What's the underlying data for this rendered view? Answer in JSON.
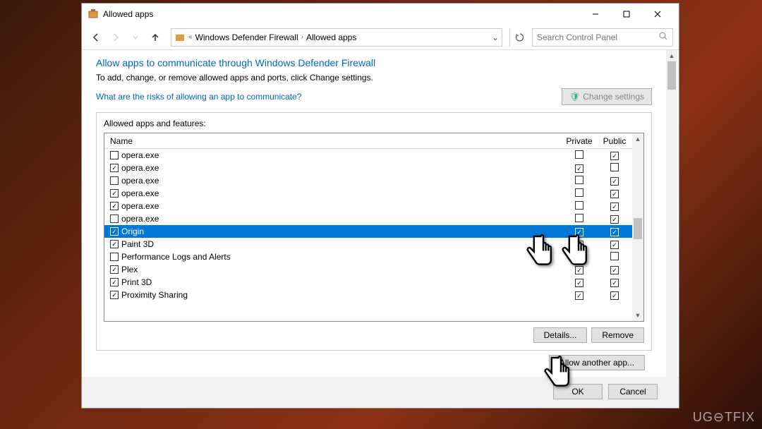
{
  "window": {
    "title": "Allowed apps"
  },
  "toolbar": {
    "breadcrumb": [
      "Windows Defender Firewall",
      "Allowed apps"
    ],
    "search_placeholder": "Search Control Panel"
  },
  "page": {
    "title": "Allow apps to communicate through Windows Defender Firewall",
    "subtitle": "To add, change, or remove allowed apps and ports, click Change settings.",
    "help_link": "What are the risks of allowing an app to communicate?",
    "change_settings_label": "Change settings"
  },
  "groupbox": {
    "title": "Allowed apps and features:",
    "columns": {
      "name": "Name",
      "private": "Private",
      "public": "Public"
    },
    "rows": [
      {
        "name": "opera.exe",
        "enabled": false,
        "private": false,
        "public": true,
        "selected": false
      },
      {
        "name": "opera.exe",
        "enabled": true,
        "private": true,
        "public": false,
        "selected": false
      },
      {
        "name": "opera.exe",
        "enabled": false,
        "private": false,
        "public": true,
        "selected": false
      },
      {
        "name": "opera.exe",
        "enabled": true,
        "private": false,
        "public": true,
        "selected": false
      },
      {
        "name": "opera.exe",
        "enabled": true,
        "private": false,
        "public": true,
        "selected": false
      },
      {
        "name": "opera.exe",
        "enabled": false,
        "private": false,
        "public": true,
        "selected": false
      },
      {
        "name": "Origin",
        "enabled": true,
        "private": true,
        "public": true,
        "selected": true
      },
      {
        "name": "Paint 3D",
        "enabled": true,
        "private": true,
        "public": true,
        "selected": false
      },
      {
        "name": "Performance Logs and Alerts",
        "enabled": false,
        "private": true,
        "public": false,
        "selected": false
      },
      {
        "name": "Plex",
        "enabled": true,
        "private": true,
        "public": true,
        "selected": false
      },
      {
        "name": "Print 3D",
        "enabled": true,
        "private": true,
        "public": true,
        "selected": false
      },
      {
        "name": "Proximity Sharing",
        "enabled": true,
        "private": true,
        "public": true,
        "selected": false
      }
    ],
    "details_label": "Details...",
    "remove_label": "Remove"
  },
  "allow_another_label": "Allow another app...",
  "ok_label": "OK",
  "cancel_label": "Cancel",
  "watermark": "UG⊖TFIX"
}
